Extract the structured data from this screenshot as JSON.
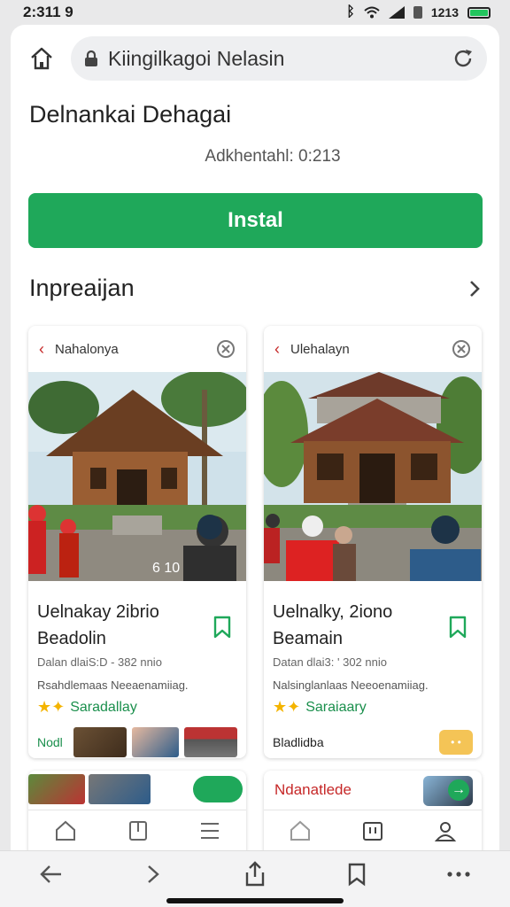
{
  "status_bar": {
    "time": "2:311 9",
    "right_text": "1213"
  },
  "browser": {
    "url": "Kiingilkagoi Nelasin"
  },
  "page": {
    "title": "Delnankai Dehagai",
    "subtitle": "Adkhentahl: 0:213",
    "install_label": "Instal",
    "section_title": "Inpreaijan"
  },
  "cards": [
    {
      "header": "Nahalonya",
      "title_line1": "Uelnakay 2ibrio",
      "title_line2": "Beadolin",
      "meta1": "Dalan dlaiS:D - 382 nnio",
      "meta2": "Rsahdlemaas Neeaenamiiag.",
      "rating_label": "Saradallay",
      "footer_label": "Nodl",
      "photo_caption": "6 10"
    },
    {
      "header": "Ulehalayn",
      "title_line1": "Uelnalky, 2iono",
      "title_line2": "Beamain",
      "meta1": "Datan dlai3: ' 302 nnio",
      "meta2": "Nalsinglanlaas Neeoenamiiag.",
      "rating_label": "Saraiaary",
      "footer_label": "Bladlidba"
    }
  ],
  "lower_card": {
    "title": "Ndanatlede"
  },
  "colors": {
    "accent": "#1fa85a",
    "rating_star": "#f4b400",
    "tag": "#f4c456",
    "lower_title": "#c62828"
  },
  "icons": [
    "home-icon",
    "lock-icon",
    "reload-icon",
    "chevron-right-icon",
    "back-arrow-icon",
    "close-circle-icon",
    "bookmark-icon",
    "star-icon",
    "share-icon",
    "more-icon"
  ]
}
